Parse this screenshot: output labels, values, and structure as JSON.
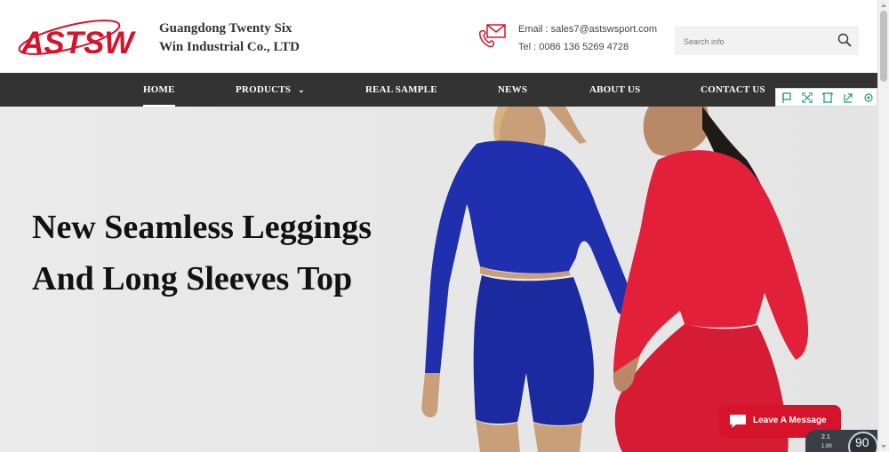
{
  "header": {
    "logo_text": "ASTSW",
    "company_line1": "Guangdong Twenty Six",
    "company_line2": "Win Industrial Co., LTD",
    "email": "Email : sales7@astswsport.com",
    "tel": "Tel : 0086 136 5269 4728",
    "search_placeholder": "Search info"
  },
  "nav": {
    "items": [
      {
        "label": "HOME",
        "active": true
      },
      {
        "label": "PRODUCTS",
        "dropdown": true
      },
      {
        "label": "REAL SAMPLE"
      },
      {
        "label": "NEWS"
      },
      {
        "label": "ABOUT US"
      },
      {
        "label": "CONTACT US"
      }
    ],
    "chevron": "⌄"
  },
  "hero": {
    "line1": "New Seamless Leggings",
    "line2": "And Long Sleeves Top"
  },
  "widgets": {
    "leave_message": "Leave A Message",
    "speed_a": "2.1",
    "speed_b": "1.00",
    "percent": "90"
  },
  "colors": {
    "brand_red": "#d5132a",
    "nav_bg": "#333333",
    "hero_bg": "#ebebeb",
    "top_blue": "#1f2fae",
    "top_red": "#e2203a"
  },
  "icons": [
    "email-icon",
    "phone-icon",
    "search-icon",
    "chat-icon",
    "tool-icons"
  ]
}
